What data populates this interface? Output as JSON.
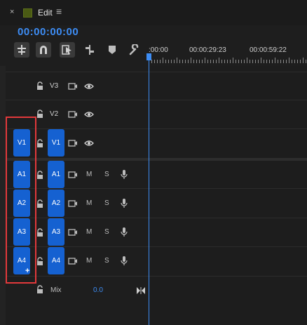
{
  "header": {
    "close_glyph": "×",
    "title": "Edit",
    "menu_glyph": "≡",
    "timecode": "00:00:00:00",
    "sequence_color": "#4a5a14"
  },
  "toolbar": {
    "tools": [
      "insert-overwrite-icon",
      "snap-icon",
      "linked-selection-icon",
      "add-marker-icon",
      "marker-icon",
      "wrench-icon"
    ]
  },
  "ruler": {
    "labels": [
      ":00:00",
      "00:00:29:23",
      "00:00:59:22"
    ]
  },
  "tracks": {
    "video": [
      {
        "label": "V3",
        "source": "",
        "target": false
      },
      {
        "label": "V2",
        "source": "",
        "target": false
      },
      {
        "label": "V1",
        "source": "V1",
        "target": true
      }
    ],
    "audio": [
      {
        "label": "A1",
        "source": "A1",
        "mute": "M",
        "solo": "S"
      },
      {
        "label": "A2",
        "source": "A2",
        "mute": "M",
        "solo": "S"
      },
      {
        "label": "A3",
        "source": "A3",
        "mute": "M",
        "solo": "S"
      },
      {
        "label": "A4",
        "source": "A4",
        "mute": "M",
        "solo": "S"
      }
    ]
  },
  "mix": {
    "label": "Mix",
    "value": "0.0"
  },
  "colors": {
    "accent": "#3d8df5",
    "button_blue": "#1561d1",
    "highlight_red": "#e2393b"
  }
}
